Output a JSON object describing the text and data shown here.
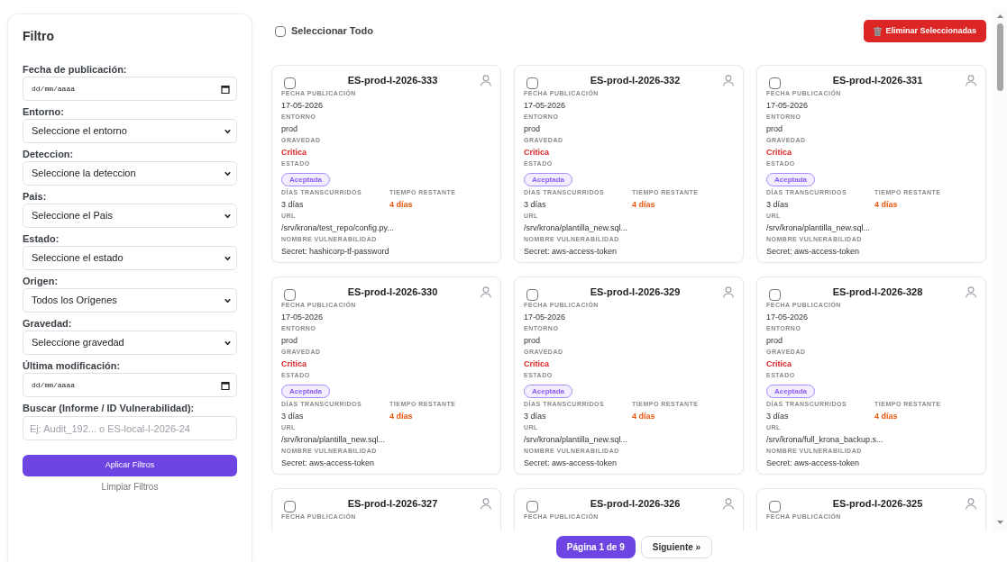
{
  "filter_panel": {
    "title": "Filtro",
    "fields": [
      {
        "kind": "date",
        "label": "Fecha de publicación:",
        "placeholder": "dd/mm/aaaa"
      },
      {
        "kind": "select",
        "label": "Entorno:",
        "value": "Seleccione el entorno"
      },
      {
        "kind": "select",
        "label": "Deteccion:",
        "value": "Seleccione la deteccion"
      },
      {
        "kind": "select",
        "label": "Pais:",
        "value": "Seleccione el Pais"
      },
      {
        "kind": "select",
        "label": "Estado:",
        "value": "Seleccione el estado"
      },
      {
        "kind": "select",
        "label": "Origen:",
        "value": "Todos los Orígenes"
      },
      {
        "kind": "select",
        "label": "Gravedad:",
        "value": "Seleccione gravedad"
      },
      {
        "kind": "date",
        "label": "Última modificación:",
        "placeholder": "dd/mm/aaaa"
      },
      {
        "kind": "text",
        "label": "Buscar (Informe / ID Vulnerabilidad):",
        "placeholder": "Ej: Audit_192... o ES-local-I-2026-24"
      }
    ],
    "apply_button": "Aplicar Filtros",
    "clear_link": "Limpiar Filtros"
  },
  "toolbar": {
    "select_all": {
      "label": "Seleccionar Todo",
      "checked": false
    },
    "delete_button": "Eliminar Seleccionadas"
  },
  "cards": [
    {
      "title": "ES-prod-I-2026-333",
      "checked": false,
      "fields": [
        {
          "kind": "text",
          "label": "FECHA PUBLICACIÓN",
          "value": "17-05-2026"
        },
        {
          "kind": "text",
          "label": "ENTORNO",
          "value": "prod"
        },
        {
          "kind": "severity",
          "label": "GRAVEDAD",
          "value": "Critica"
        },
        {
          "kind": "status",
          "label": "ESTADO",
          "value": "Aceptada"
        },
        {
          "kind": "split",
          "columns": [
            {
              "kind": "text",
              "label": "DÍAS TRANSCURRIDOS",
              "value": "3 días"
            },
            {
              "kind": "remaining",
              "label": "TIEMPO RESTANTE",
              "value": "4 días"
            }
          ]
        },
        {
          "kind": "text",
          "label": "URL",
          "value": "/srv/krona/test_repo/config.py..."
        },
        {
          "kind": "text",
          "label": "NOMBRE VULNERABILIDAD",
          "value": "Secret: hashicorp-tf-password"
        }
      ]
    },
    {
      "title": "ES-prod-I-2026-332",
      "checked": false,
      "fields": [
        {
          "kind": "text",
          "label": "FECHA PUBLICACIÓN",
          "value": "17-05-2026"
        },
        {
          "kind": "text",
          "label": "ENTORNO",
          "value": "prod"
        },
        {
          "kind": "severity",
          "label": "GRAVEDAD",
          "value": "Critica"
        },
        {
          "kind": "status",
          "label": "ESTADO",
          "value": "Aceptada"
        },
        {
          "kind": "split",
          "columns": [
            {
              "kind": "text",
              "label": "DÍAS TRANSCURRIDOS",
              "value": "3 días"
            },
            {
              "kind": "remaining",
              "label": "TIEMPO RESTANTE",
              "value": "4 días"
            }
          ]
        },
        {
          "kind": "text",
          "label": "URL",
          "value": "/srv/krona/plantilla_new.sql..."
        },
        {
          "kind": "text",
          "label": "NOMBRE VULNERABILIDAD",
          "value": "Secret: aws-access-token"
        }
      ]
    },
    {
      "title": "ES-prod-I-2026-331",
      "checked": false,
      "fields": [
        {
          "kind": "text",
          "label": "FECHA PUBLICACIÓN",
          "value": "17-05-2026"
        },
        {
          "kind": "text",
          "label": "ENTORNO",
          "value": "prod"
        },
        {
          "kind": "severity",
          "label": "GRAVEDAD",
          "value": "Critica"
        },
        {
          "kind": "status",
          "label": "ESTADO",
          "value": "Aceptada"
        },
        {
          "kind": "split",
          "columns": [
            {
              "kind": "text",
              "label": "DÍAS TRANSCURRIDOS",
              "value": "3 días"
            },
            {
              "kind": "remaining",
              "label": "TIEMPO RESTANTE",
              "value": "4 días"
            }
          ]
        },
        {
          "kind": "text",
          "label": "URL",
          "value": "/srv/krona/plantilla_new.sql..."
        },
        {
          "kind": "text",
          "label": "NOMBRE VULNERABILIDAD",
          "value": "Secret: aws-access-token"
        }
      ]
    },
    {
      "title": "ES-prod-I-2026-330",
      "checked": false,
      "fields": [
        {
          "kind": "text",
          "label": "FECHA PUBLICACIÓN",
          "value": "17-05-2026"
        },
        {
          "kind": "text",
          "label": "ENTORNO",
          "value": "prod"
        },
        {
          "kind": "severity",
          "label": "GRAVEDAD",
          "value": "Critica"
        },
        {
          "kind": "status",
          "label": "ESTADO",
          "value": "Aceptada"
        },
        {
          "kind": "split",
          "columns": [
            {
              "kind": "text",
              "label": "DÍAS TRANSCURRIDOS",
              "value": "3 días"
            },
            {
              "kind": "remaining",
              "label": "TIEMPO RESTANTE",
              "value": "4 días"
            }
          ]
        },
        {
          "kind": "text",
          "label": "URL",
          "value": "/srv/krona/plantilla_new.sql..."
        },
        {
          "kind": "text",
          "label": "NOMBRE VULNERABILIDAD",
          "value": "Secret: aws-access-token"
        }
      ]
    },
    {
      "title": "ES-prod-I-2026-329",
      "checked": false,
      "fields": [
        {
          "kind": "text",
          "label": "FECHA PUBLICACIÓN",
          "value": "17-05-2026"
        },
        {
          "kind": "text",
          "label": "ENTORNO",
          "value": "prod"
        },
        {
          "kind": "severity",
          "label": "GRAVEDAD",
          "value": "Critica"
        },
        {
          "kind": "status",
          "label": "ESTADO",
          "value": "Aceptada"
        },
        {
          "kind": "split",
          "columns": [
            {
              "kind": "text",
              "label": "DÍAS TRANSCURRIDOS",
              "value": "3 días"
            },
            {
              "kind": "remaining",
              "label": "TIEMPO RESTANTE",
              "value": "4 días"
            }
          ]
        },
        {
          "kind": "text",
          "label": "URL",
          "value": "/srv/krona/plantilla_new.sql..."
        },
        {
          "kind": "text",
          "label": "NOMBRE VULNERABILIDAD",
          "value": "Secret: aws-access-token"
        }
      ]
    },
    {
      "title": "ES-prod-I-2026-328",
      "checked": false,
      "fields": [
        {
          "kind": "text",
          "label": "FECHA PUBLICACIÓN",
          "value": "17-05-2026"
        },
        {
          "kind": "text",
          "label": "ENTORNO",
          "value": "prod"
        },
        {
          "kind": "severity",
          "label": "GRAVEDAD",
          "value": "Critica"
        },
        {
          "kind": "status",
          "label": "ESTADO",
          "value": "Aceptada"
        },
        {
          "kind": "split",
          "columns": [
            {
              "kind": "text",
              "label": "DÍAS TRANSCURRIDOS",
              "value": "3 días"
            },
            {
              "kind": "remaining",
              "label": "TIEMPO RESTANTE",
              "value": "4 días"
            }
          ]
        },
        {
          "kind": "text",
          "label": "URL",
          "value": "/srv/krona/full_krona_backup.s..."
        },
        {
          "kind": "text",
          "label": "NOMBRE VULNERABILIDAD",
          "value": "Secret: aws-access-token"
        }
      ]
    },
    {
      "title": "ES-prod-I-2026-327",
      "checked": false,
      "fields": [
        {
          "kind": "text",
          "label": "FECHA PUBLICACIÓN"
        }
      ]
    },
    {
      "title": "ES-prod-I-2026-326",
      "checked": false,
      "fields": [
        {
          "kind": "text",
          "label": "FECHA PUBLICACIÓN"
        }
      ]
    },
    {
      "title": "ES-prod-I-2026-325",
      "checked": false,
      "fields": [
        {
          "kind": "text",
          "label": "FECHA PUBLICACIÓN"
        }
      ]
    }
  ],
  "pagination": {
    "page_indicator": "Página 1 de 9",
    "next_button": "Siguiente »"
  }
}
